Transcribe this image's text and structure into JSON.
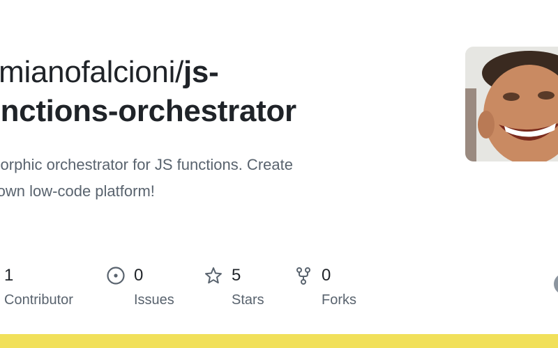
{
  "repo": {
    "owner": "amianofalcioni/",
    "name": "js-functions-orchestrator",
    "name_line1": "js-",
    "name_line2": "unctions-orchestrator",
    "description_line1": "omorphic orchestrator for JS functions. Create",
    "description_line2": "ur own low-code platform!"
  },
  "stats": {
    "contributors": {
      "value": "1",
      "label": "Contributor",
      "icon": "people-icon"
    },
    "issues": {
      "value": "0",
      "label": "Issues",
      "icon": "issue-circle-icon"
    },
    "stars": {
      "value": "5",
      "label": "Stars",
      "icon": "star-icon"
    },
    "forks": {
      "value": "0",
      "label": "Forks",
      "icon": "fork-icon"
    }
  },
  "colors": {
    "text": "#1f2328",
    "muted": "#59636e",
    "language_bar": "#f1e05a"
  }
}
